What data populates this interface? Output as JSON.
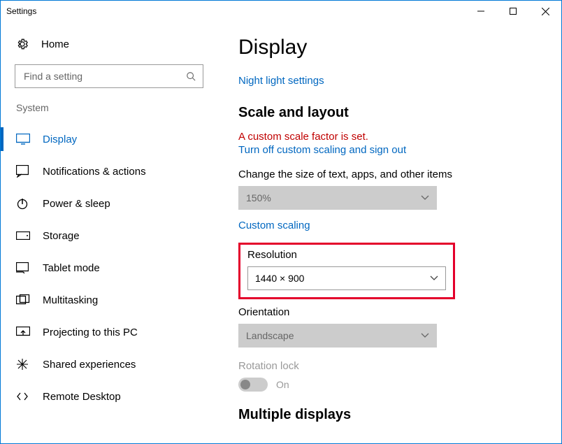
{
  "window": {
    "title": "Settings"
  },
  "sidebar": {
    "home_label": "Home",
    "search_placeholder": "Find a setting",
    "section_label": "System",
    "items": [
      {
        "label": "Display"
      },
      {
        "label": "Notifications & actions"
      },
      {
        "label": "Power & sleep"
      },
      {
        "label": "Storage"
      },
      {
        "label": "Tablet mode"
      },
      {
        "label": "Multitasking"
      },
      {
        "label": "Projecting to this PC"
      },
      {
        "label": "Shared experiences"
      },
      {
        "label": "Remote Desktop"
      }
    ]
  },
  "main": {
    "title": "Display",
    "night_light_link": "Night light settings",
    "scale_heading": "Scale and layout",
    "warning_text": "A custom scale factor is set.",
    "turn_off_link": "Turn off custom scaling and sign out",
    "scale_label": "Change the size of text, apps, and other items",
    "scale_value": "150%",
    "custom_scaling_link": "Custom scaling",
    "resolution_label": "Resolution",
    "resolution_value": "1440 × 900",
    "orientation_label": "Orientation",
    "orientation_value": "Landscape",
    "rotation_lock_label": "Rotation lock",
    "rotation_lock_state": "On",
    "multiple_displays_heading": "Multiple displays"
  }
}
